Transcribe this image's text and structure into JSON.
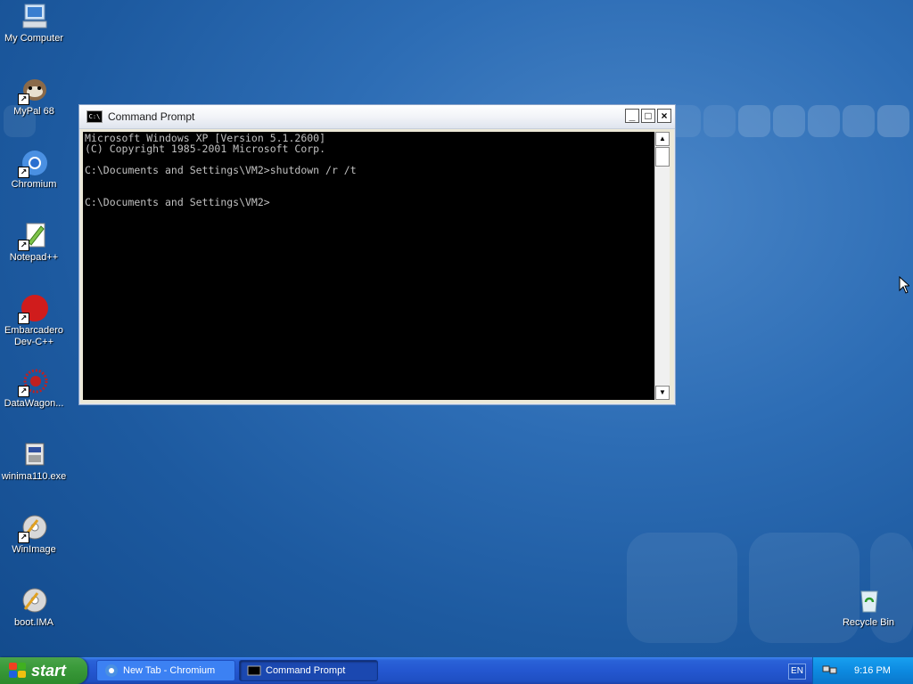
{
  "desktop": {
    "icons": [
      {
        "label": "My Computer"
      },
      {
        "label": "MyPal 68"
      },
      {
        "label": "Chromium"
      },
      {
        "label": "Notepad++"
      },
      {
        "label": "Embarcadero Dev-C++"
      },
      {
        "label": "DataWagon..."
      },
      {
        "label": "winima110.exe"
      },
      {
        "label": "WinImage"
      },
      {
        "label": "boot.IMA"
      },
      {
        "label": "Recycle Bin"
      }
    ]
  },
  "window": {
    "title": "Command Prompt",
    "title_icon_text": "C:\\",
    "minimize": "_",
    "maximize": "□",
    "close": "×",
    "console_text": "Microsoft Windows XP [Version 5.1.2600]\n(C) Copyright 1985-2001 Microsoft Corp.\n\nC:\\Documents and Settings\\VM2>shutdown /r /t\n\n\nC:\\Documents and Settings\\VM2>"
  },
  "taskbar": {
    "start_label": "start",
    "buttons": [
      {
        "label": "New Tab - Chromium"
      },
      {
        "label": "Command Prompt"
      }
    ],
    "language": "EN",
    "clock": "9:16 PM"
  },
  "colors": {
    "desktop": "#2d6db5",
    "taskbar": "#2457d0",
    "start": "#3a9a3a",
    "console_bg": "#000000",
    "console_fg": "#c0c0c0"
  }
}
